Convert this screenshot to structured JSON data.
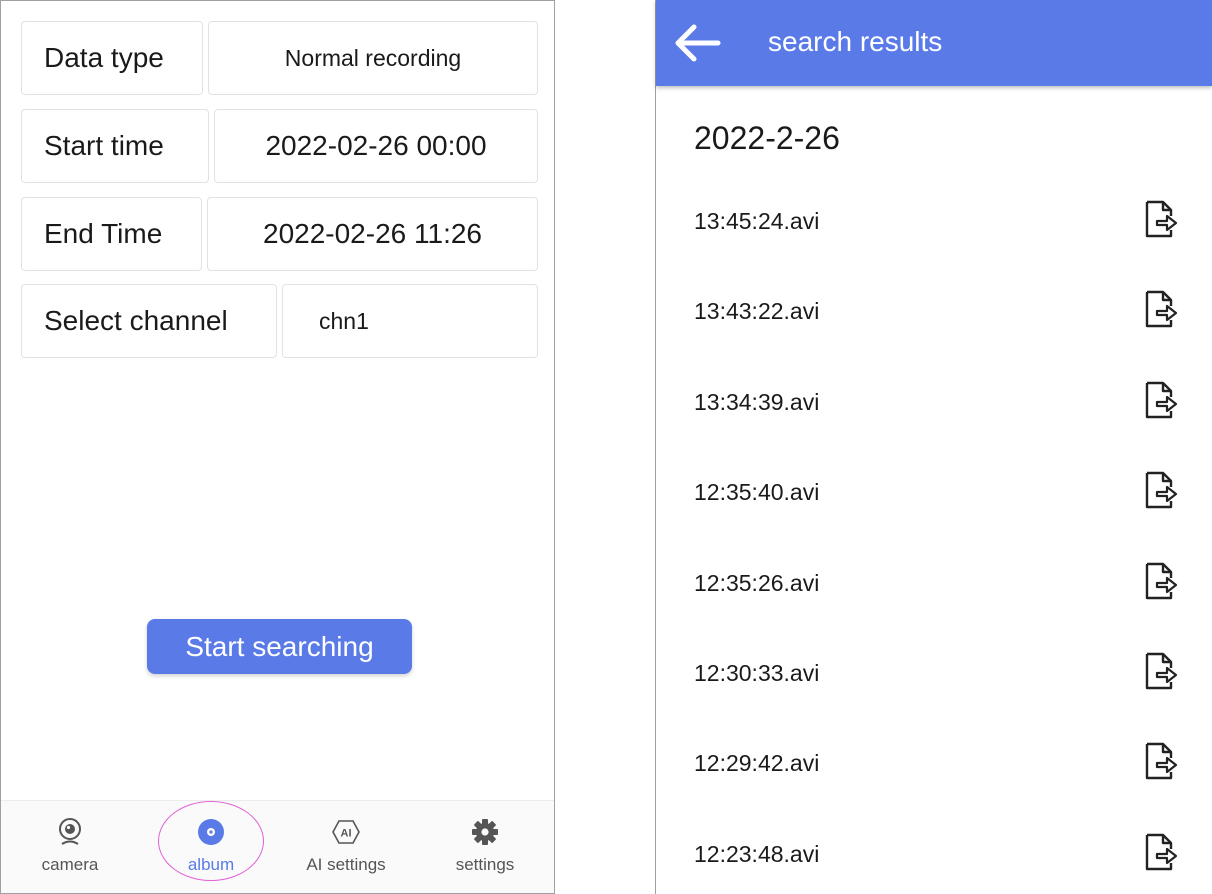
{
  "search_form": {
    "data_type": {
      "label": "Data type",
      "value": "Normal recording"
    },
    "start_time": {
      "label": "Start time",
      "value": "2022-02-26 00:00"
    },
    "end_time": {
      "label": "End Time",
      "value": "2022-02-26 11:26"
    },
    "channel": {
      "label": "Select channel",
      "value": "chn1"
    },
    "search_button": "Start searching"
  },
  "bottom_nav": {
    "items": [
      {
        "label": "camera",
        "icon": "webcam-icon",
        "active": false
      },
      {
        "label": "album",
        "icon": "album-disc-icon",
        "active": true
      },
      {
        "label": "AI settings",
        "icon": "ai-badge-icon",
        "active": false
      },
      {
        "label": "settings",
        "icon": "gear-icon",
        "active": false
      }
    ]
  },
  "results": {
    "title": "search results",
    "date": "2022-2-26",
    "files": [
      "13:45:24.avi",
      "13:43:22.avi",
      "13:34:39.avi",
      "12:35:40.avi",
      "12:35:26.avi",
      "12:30:33.avi",
      "12:29:42.avi",
      "12:23:48.avi"
    ],
    "file_action_icon": "file-export-icon"
  },
  "colors": {
    "accent": "#5a7ae8",
    "highlight_annotation": "#e060d6"
  }
}
